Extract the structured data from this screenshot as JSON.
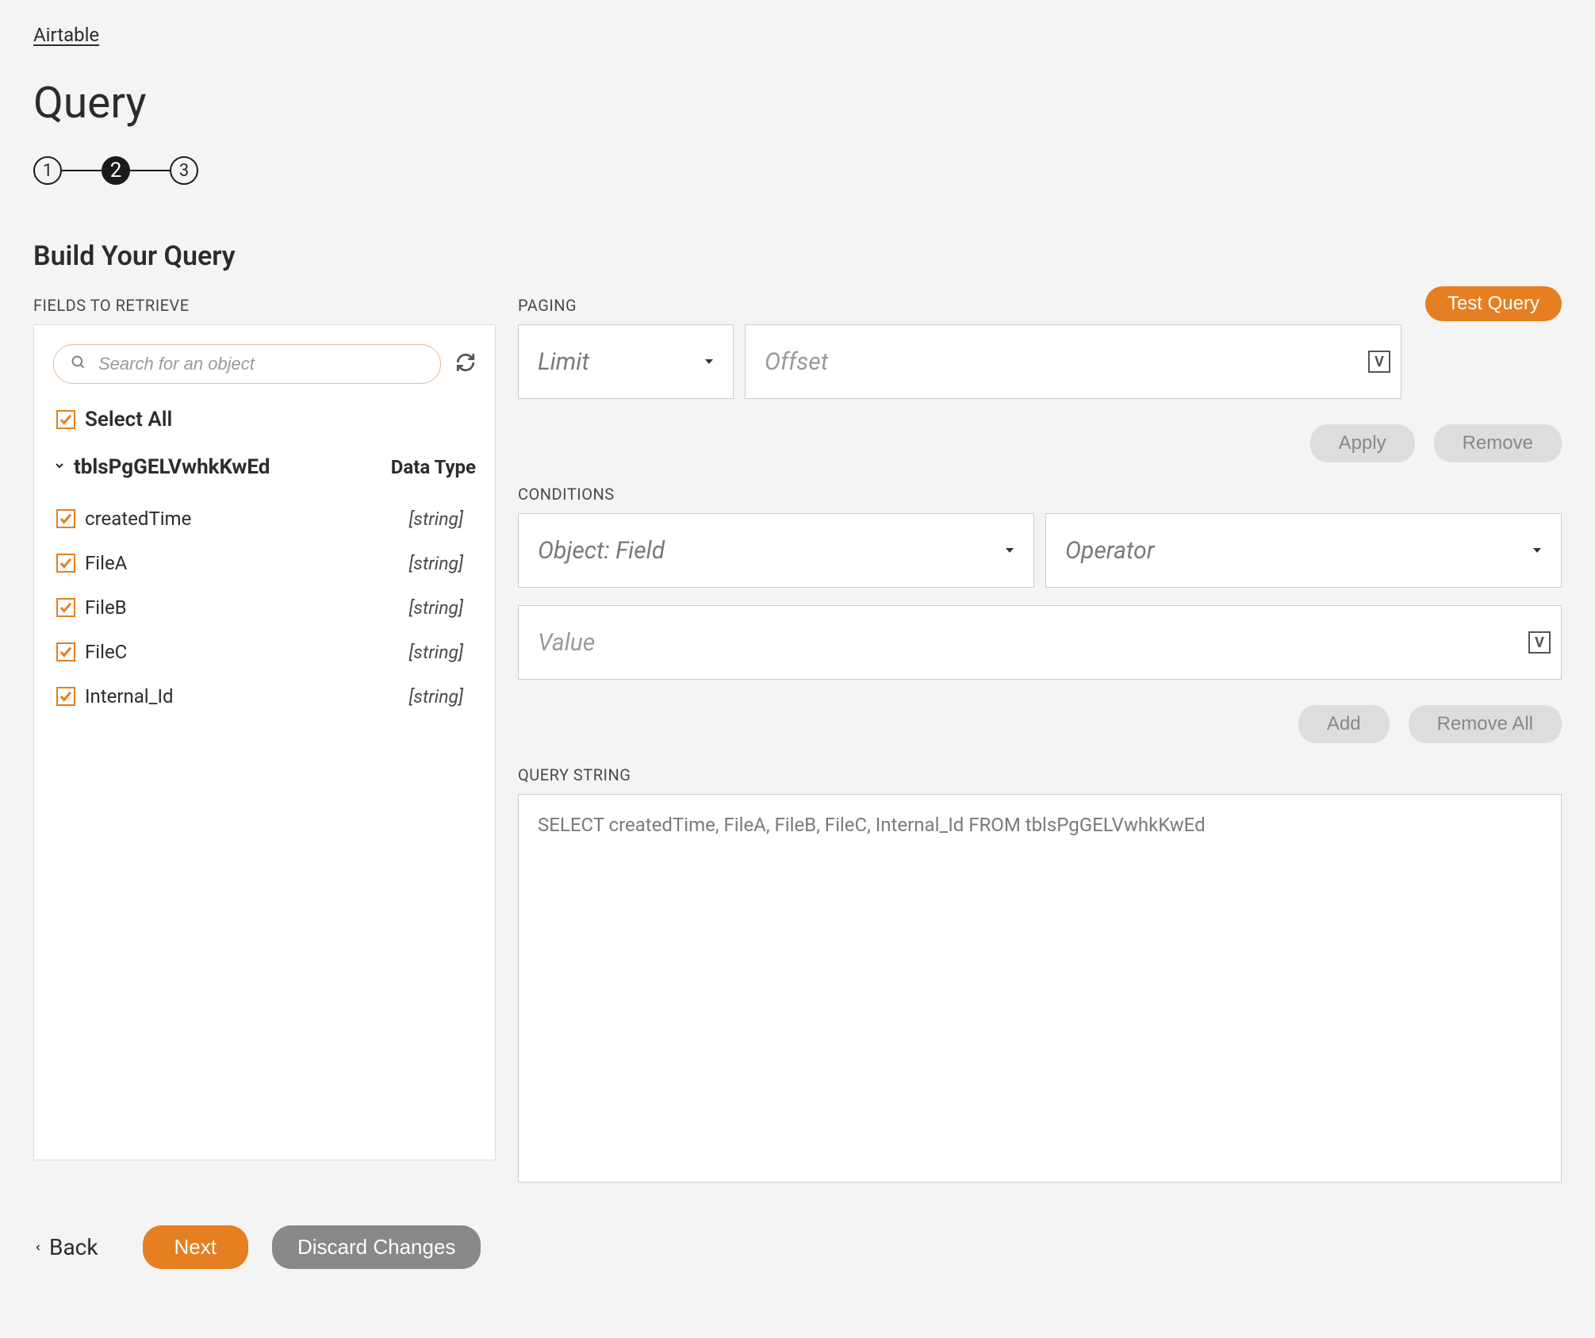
{
  "breadcrumb": {
    "label": "Airtable"
  },
  "page_title": "Query",
  "stepper": {
    "steps": [
      "1",
      "2",
      "3"
    ],
    "active_index": 1
  },
  "section_title": "Build Your Query",
  "fields_panel": {
    "label": "FIELDS TO RETRIEVE",
    "search_placeholder": "Search for an object",
    "select_all_label": "Select All",
    "table_name": "tblsPgGELVwhkKwEd",
    "datatype_header": "Data Type",
    "fields": [
      {
        "name": "createdTime",
        "type": "[string]",
        "checked": true
      },
      {
        "name": "FileA",
        "type": "[string]",
        "checked": true
      },
      {
        "name": "FileB",
        "type": "[string]",
        "checked": true
      },
      {
        "name": "FileC",
        "type": "[string]",
        "checked": true
      },
      {
        "name": "Internal_Id",
        "type": "[string]",
        "checked": true
      }
    ]
  },
  "paging": {
    "label": "PAGING",
    "limit_placeholder": "Limit",
    "offset_placeholder": "Offset"
  },
  "test_query_label": "Test Query",
  "buttons": {
    "apply": "Apply",
    "remove": "Remove",
    "add": "Add",
    "remove_all": "Remove All"
  },
  "conditions": {
    "label": "CONDITIONS",
    "object_field_placeholder": "Object: Field",
    "operator_placeholder": "Operator",
    "value_placeholder": "Value"
  },
  "query_string": {
    "label": "QUERY STRING",
    "value": "SELECT createdTime, FileA, FileB, FileC, Internal_Id FROM tblsPgGELVwhkKwEd"
  },
  "footer": {
    "back": "Back",
    "next": "Next",
    "discard": "Discard Changes"
  }
}
